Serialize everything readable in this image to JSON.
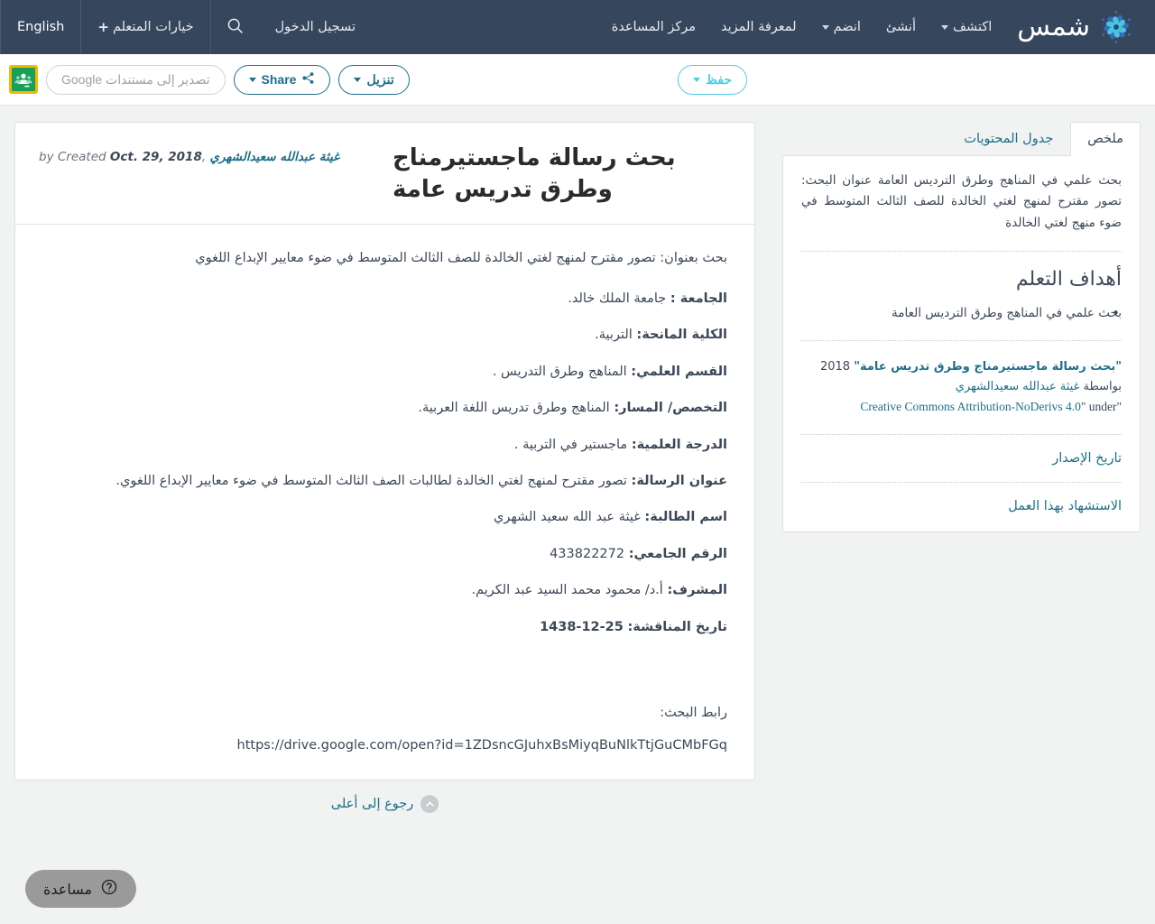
{
  "topnav": {
    "brand": {
      "name": "شمس",
      "icon": "pinwheel-logo-icon"
    },
    "links": [
      {
        "label": "اكتشف",
        "has_caret": true
      },
      {
        "label": "أنشئ",
        "has_caret": false
      },
      {
        "label": "انضم",
        "has_caret": true
      },
      {
        "label": "لمعرفة المزيد",
        "has_caret": false
      },
      {
        "label": "مركز المساعدة",
        "has_caret": false
      }
    ],
    "login": "تسجيل الدخول",
    "search_icon": "search-icon",
    "learner_options": "خيارات المتعلم",
    "plus": "+",
    "english": "English"
  },
  "toolbar": {
    "save_label": "حفظ",
    "download_label": "تنزيل",
    "share_label": "Share",
    "export_google_docs": "تصدير إلى مستندات Google",
    "classroom_icon": "google-classroom-icon"
  },
  "sidebar": {
    "tabs": [
      {
        "label": "جدول المحتويات",
        "active": false
      },
      {
        "label": "ملخص",
        "active": true
      }
    ],
    "summary": "بحث علمي في المناهج وطرق الترديس العامة عنوان البحث: تصور مقترح لمنهج لغتي الخالدة للصف الثالث المتوسط في ضوء منهج لغتي الخالدة",
    "goals_title": "أهداف التعلم",
    "goals": [
      "بحث علمي في المناهج وطرق الترديس العامة"
    ],
    "license": {
      "work_title": "\"بحث رسالة ماجستيرمناج وطرق تدريس عامة\"",
      "year": "2018",
      "by_word": "بواسطة",
      "author": "غيثة عبدالله سعيدالشهري",
      "under_word": "under",
      "license_name": "Creative Commons Attribution-NoDerivs 4.0"
    },
    "version_date_link": "تاريخ الإصدار",
    "cite_link": "الاستشهاد بهذا العمل"
  },
  "document": {
    "title": "بحث رسالة ماجستيرمناج وطرق تدريس عامة",
    "byline": {
      "by_word": "by",
      "created_word": "Created",
      "created_date": "Oct. 29, 2018",
      "author": "غيثة عبدالله سعيدالشهري"
    },
    "intro": "بحث بعنوان: تصور مقترح لمنهج لغتي الخالدة للصف الثالث المتوسط في ضوء معايير الإبداع اللغوي",
    "fields": [
      {
        "label": "الجامعة :",
        "value": "جامعة الملك خالد."
      },
      {
        "label": "الكلية المانحة:",
        "value": "التربية."
      },
      {
        "label": "القسم العلمي:",
        "value": "المناهج وطرق التدريس ."
      },
      {
        "label": "التخصص/ المسار:",
        "value": "المناهج وطرق تدريس اللغة العربية."
      },
      {
        "label": "الدرجة العلمية:",
        "value": "ماجستير في التربية ."
      },
      {
        "label": "عنوان الرسالة:",
        "value": "تصور مقترح لمنهج لغتي الخالدة لطالبات الصف الثالث المتوسط في ضوء معايير الإبداع اللغوي."
      },
      {
        "label": "اسم الطالبة:",
        "value": "غيثة عبد الله سعيد الشهري"
      },
      {
        "label": "الرقم الجامعي:",
        "value": "433822272"
      },
      {
        "label": "المشرف:",
        "value": "أ.د/ محمود محمد السيد عبد الكريم."
      },
      {
        "label": "تاريخ المناقشة:",
        "value": "25-12-1438"
      }
    ],
    "research_link_label": "رابط البحث:",
    "research_url": "https://drive.google.com/open?id=1ZDsncGJuhxBsMiyqBuNlkTtjGuCMbFGq"
  },
  "back_to_top": {
    "label": "رجوع إلى أعلى",
    "icon": "chevron-up-circle-icon"
  },
  "help": {
    "label": "مساعدة",
    "icon": "question-circle-icon"
  },
  "colors": {
    "navbar_bg": "#36465d",
    "page_bg": "#f1f2f2",
    "accent_teal": "#1d6f8b",
    "accent_cyan": "#4ecbe4",
    "classroom_green": "#17a05a",
    "classroom_yellow": "#f5b800",
    "text": "#3c4858"
  }
}
